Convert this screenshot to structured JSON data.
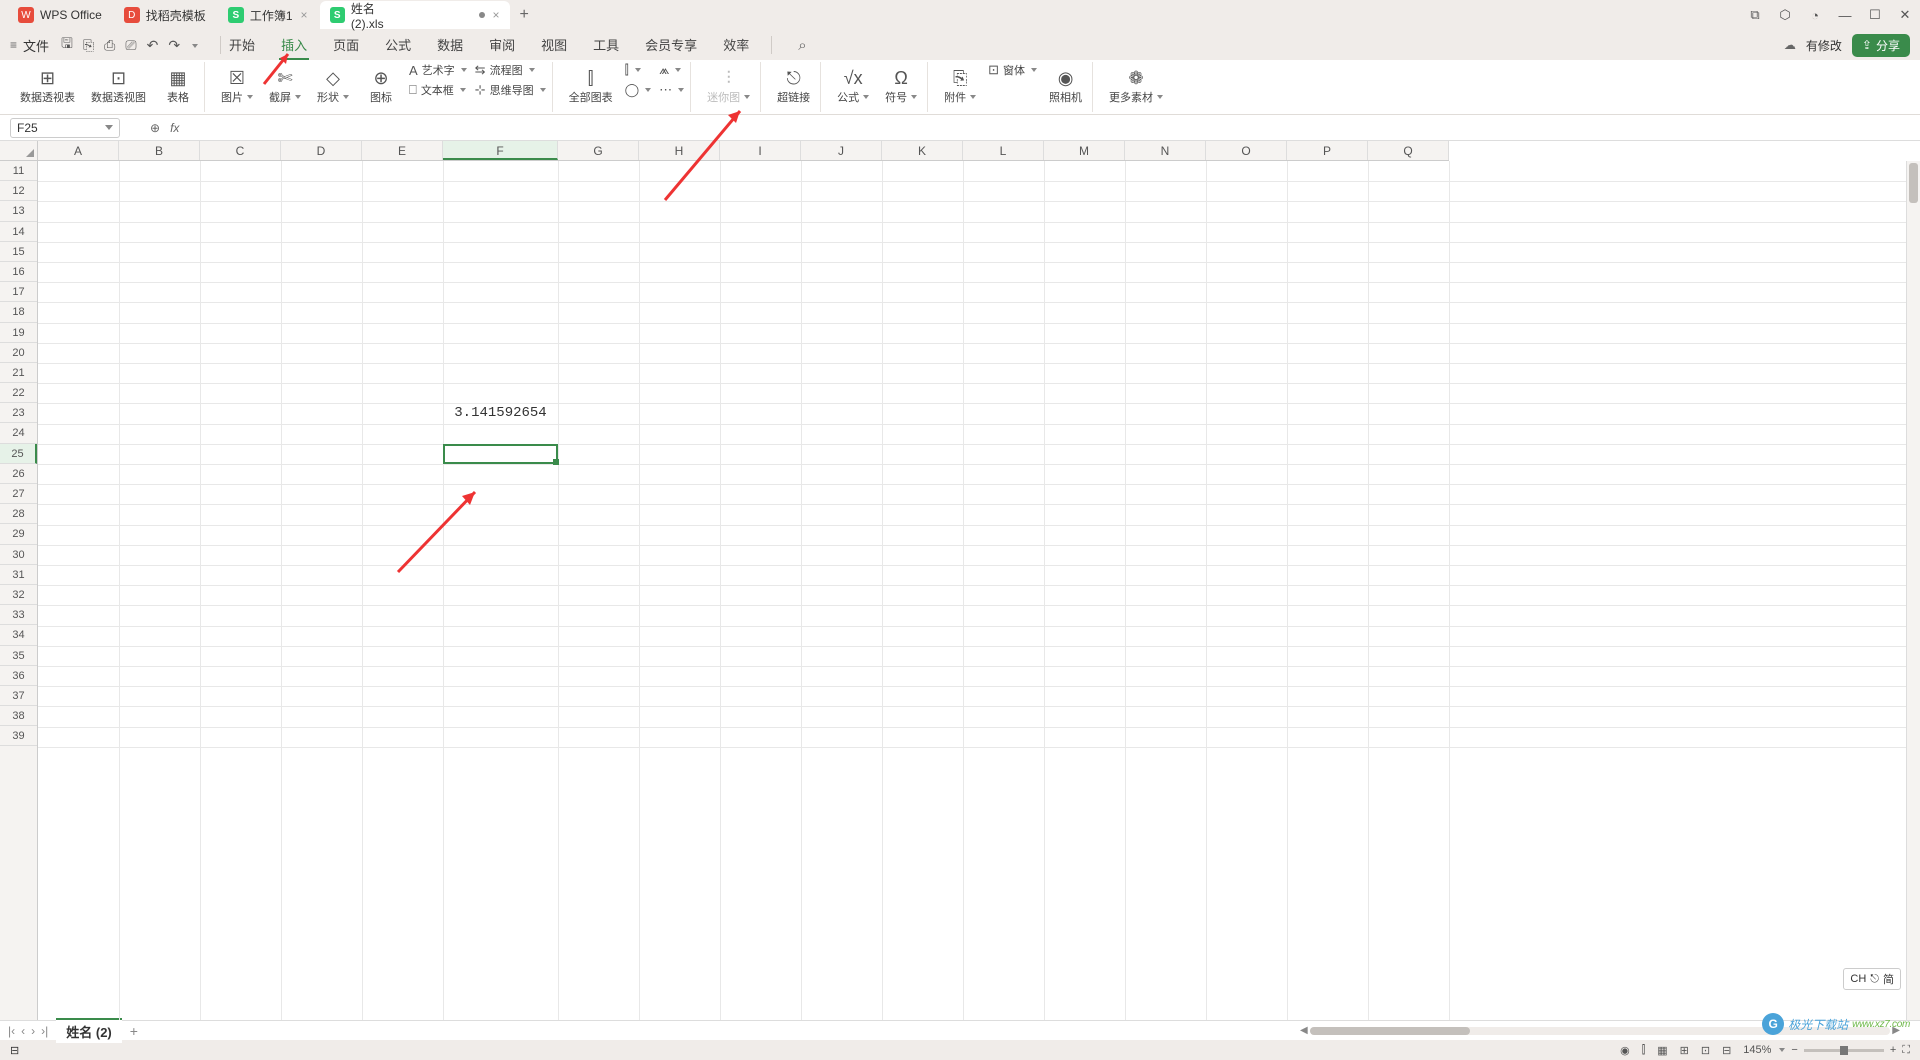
{
  "titlebar": {
    "tabs": [
      {
        "icon": "W",
        "label": "WPS Office"
      },
      {
        "icon": "D",
        "label": "找稻壳模板"
      },
      {
        "icon": "S",
        "label": "工作簿1"
      },
      {
        "icon": "S",
        "label": "姓名 (2).xls"
      }
    ],
    "newTab": "+"
  },
  "menurow": {
    "file": "文件",
    "tabs": [
      "开始",
      "插入",
      "页面",
      "公式",
      "数据",
      "审阅",
      "视图",
      "工具",
      "会员专享",
      "效率"
    ],
    "activeTab": 1,
    "modified": "有修改",
    "share": "分享"
  },
  "ribbon": {
    "g1": [
      {
        "ic": "⊞",
        "label": "数据透视表"
      },
      {
        "ic": "⊡",
        "label": "数据透视图"
      },
      {
        "ic": "▦",
        "label": "表格"
      }
    ],
    "g2": [
      {
        "ic": "☒",
        "label": "图片",
        "dd": true
      },
      {
        "ic": "✄",
        "label": "截屏",
        "dd": true
      },
      {
        "ic": "◇",
        "label": "形状",
        "dd": true
      },
      {
        "ic": "⊕",
        "label": "图标"
      }
    ],
    "g2s": [
      {
        "ic": "A",
        "label": "艺术字",
        "dd": true
      },
      {
        "ic": "⎕",
        "label": "文本框",
        "dd": true
      }
    ],
    "g2s2": [
      {
        "ic": "⇆",
        "label": "流程图",
        "dd": true
      },
      {
        "ic": "⊹",
        "label": "思维导图",
        "dd": true
      }
    ],
    "g3": [
      {
        "ic": "⫿",
        "label": "全部图表"
      }
    ],
    "g3s": [
      {
        "ic": "⫿",
        "dd": true
      },
      {
        "ic": "◯",
        "dd": true
      }
    ],
    "g3s2": [
      {
        "ic": "⩕",
        "dd": true
      },
      {
        "ic": "⋯",
        "dd": true
      }
    ],
    "g4": [
      {
        "ic": "⫶",
        "label": "迷你图",
        "dd": true,
        "disabled": true
      }
    ],
    "g5": [
      {
        "ic": "⎋",
        "label": "超链接"
      }
    ],
    "g6": [
      {
        "ic": "√x",
        "label": "公式",
        "dd": true
      },
      {
        "ic": "Ω",
        "label": "符号",
        "dd": true
      }
    ],
    "g7": [
      {
        "ic": "⎘",
        "label": "附件",
        "dd": true
      }
    ],
    "g7s": [
      {
        "ic": "⊡",
        "label": "窗体",
        "dd": true
      }
    ],
    "g7b": [
      {
        "ic": "◉",
        "label": "照相机"
      }
    ],
    "g8": [
      {
        "ic": "❁",
        "label": "更多素材",
        "dd": true
      }
    ]
  },
  "fbar": {
    "name": "F25",
    "fx": ""
  },
  "columns": [
    "A",
    "B",
    "C",
    "D",
    "E",
    "F",
    "G",
    "H",
    "I",
    "J",
    "K",
    "L",
    "M",
    "N",
    "O",
    "P",
    "Q"
  ],
  "rows_start": 11,
  "rows_end": 39,
  "cells": {
    "F23": "3.141592654"
  },
  "selected": {
    "col": "F",
    "row": 25
  },
  "sheets": {
    "nav": [
      "|‹",
      "‹",
      "›",
      "›|"
    ],
    "active": "姓名 (2)",
    "add": "+"
  },
  "statusbar": {
    "zoom": "145%"
  },
  "ime": {
    "lang": "CH",
    "mode": "简"
  },
  "watermark": {
    "brand": "极光下载站",
    "url": "www.xz7.com"
  }
}
